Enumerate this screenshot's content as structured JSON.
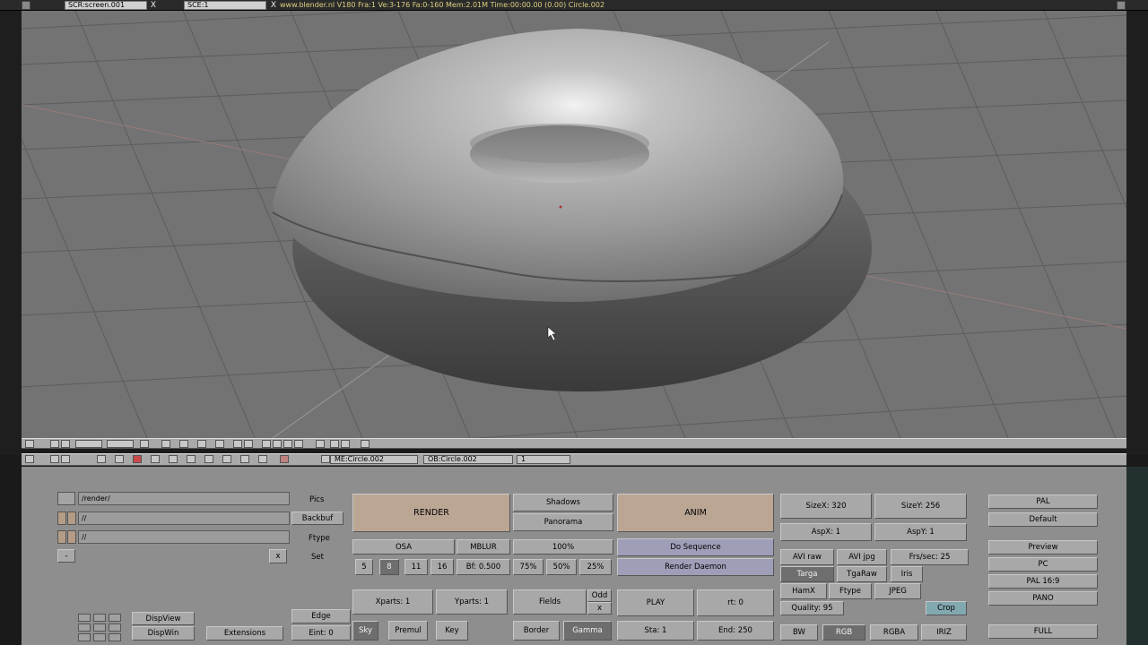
{
  "header": {
    "screen": "SCR:screen.001",
    "scene": "SCE:1",
    "info": "www.blender.nl  V180  Fra:1   Ve:3-176  Fa:0-160   Mem:2.01M  Time:00:00.00 (0.00)   Circle.002",
    "close_glyph": "X"
  },
  "buttons_header": {
    "mesh": "ME:Circle.002",
    "object": "OB:Circle.002",
    "users": "1"
  },
  "output": {
    "pics_path": "/render/",
    "backbuf_path": "//",
    "ftype_path": "//",
    "pics_label": "Pics",
    "backbuf_label": "Backbuf",
    "ftype_label": "Ftype",
    "set_label": "Set",
    "minus": "-",
    "x": "x"
  },
  "render": {
    "render_label": "RENDER",
    "shadows": "Shadows",
    "panorama": "Panorama",
    "osa": "OSA",
    "mblur": "MBLUR",
    "percent100": "100%",
    "osa_levels": [
      "5",
      "8",
      "11",
      "16"
    ],
    "bf": "Bf: 0.500",
    "percent75": "75%",
    "percent50": "50%",
    "percent25": "25%",
    "xparts": "Xparts: 1",
    "yparts": "Yparts: 1",
    "fields": "Fields",
    "odd": "Odd",
    "fx": "x",
    "sky": "Sky",
    "premul": "Premul",
    "key": "Key",
    "border": "Border",
    "gamma": "Gamma"
  },
  "anim": {
    "anim_label": "ANIM",
    "do_sequence": "Do Sequence",
    "render_daemon": "Render Daemon",
    "play": "PLAY",
    "rt": "rt: 0",
    "sta": "Sta: 1",
    "end": "End: 250"
  },
  "format": {
    "sizex": "SizeX: 320",
    "sizey": "SizeY: 256",
    "aspx": "AspX: 1",
    "aspy": "AspY: 1",
    "avi_raw": "AVI raw",
    "avi_jpg": "AVI jpg",
    "fps": "Frs/sec: 25",
    "targa": "Targa",
    "tgaraw": "TgaRaw",
    "iris": "Iris",
    "hamx": "HamX",
    "ftype": "Ftype",
    "jpeg": "JPEG",
    "quality": "Quality: 95",
    "crop": "Crop",
    "bw": "BW",
    "rgb": "RGB",
    "rgba": "RGBA",
    "iriz": "IRIZ"
  },
  "presets": {
    "pal": "PAL",
    "default": "Default",
    "preview": "Preview",
    "pc": "PC",
    "pal169": "PAL 16:9",
    "pano": "PANO",
    "full": "FULL"
  },
  "display": {
    "dispview": "DispView",
    "dispwin": "DispWin",
    "extensions": "Extensions",
    "edge": "Edge",
    "eint": "Eint: 0"
  },
  "colors": {
    "viewport_bg": "#737373",
    "grid": "#5a5a5a",
    "render_btn": "#bba694",
    "purple_btn": "#9e9eb8",
    "crop_btn": "#82a8b0"
  }
}
